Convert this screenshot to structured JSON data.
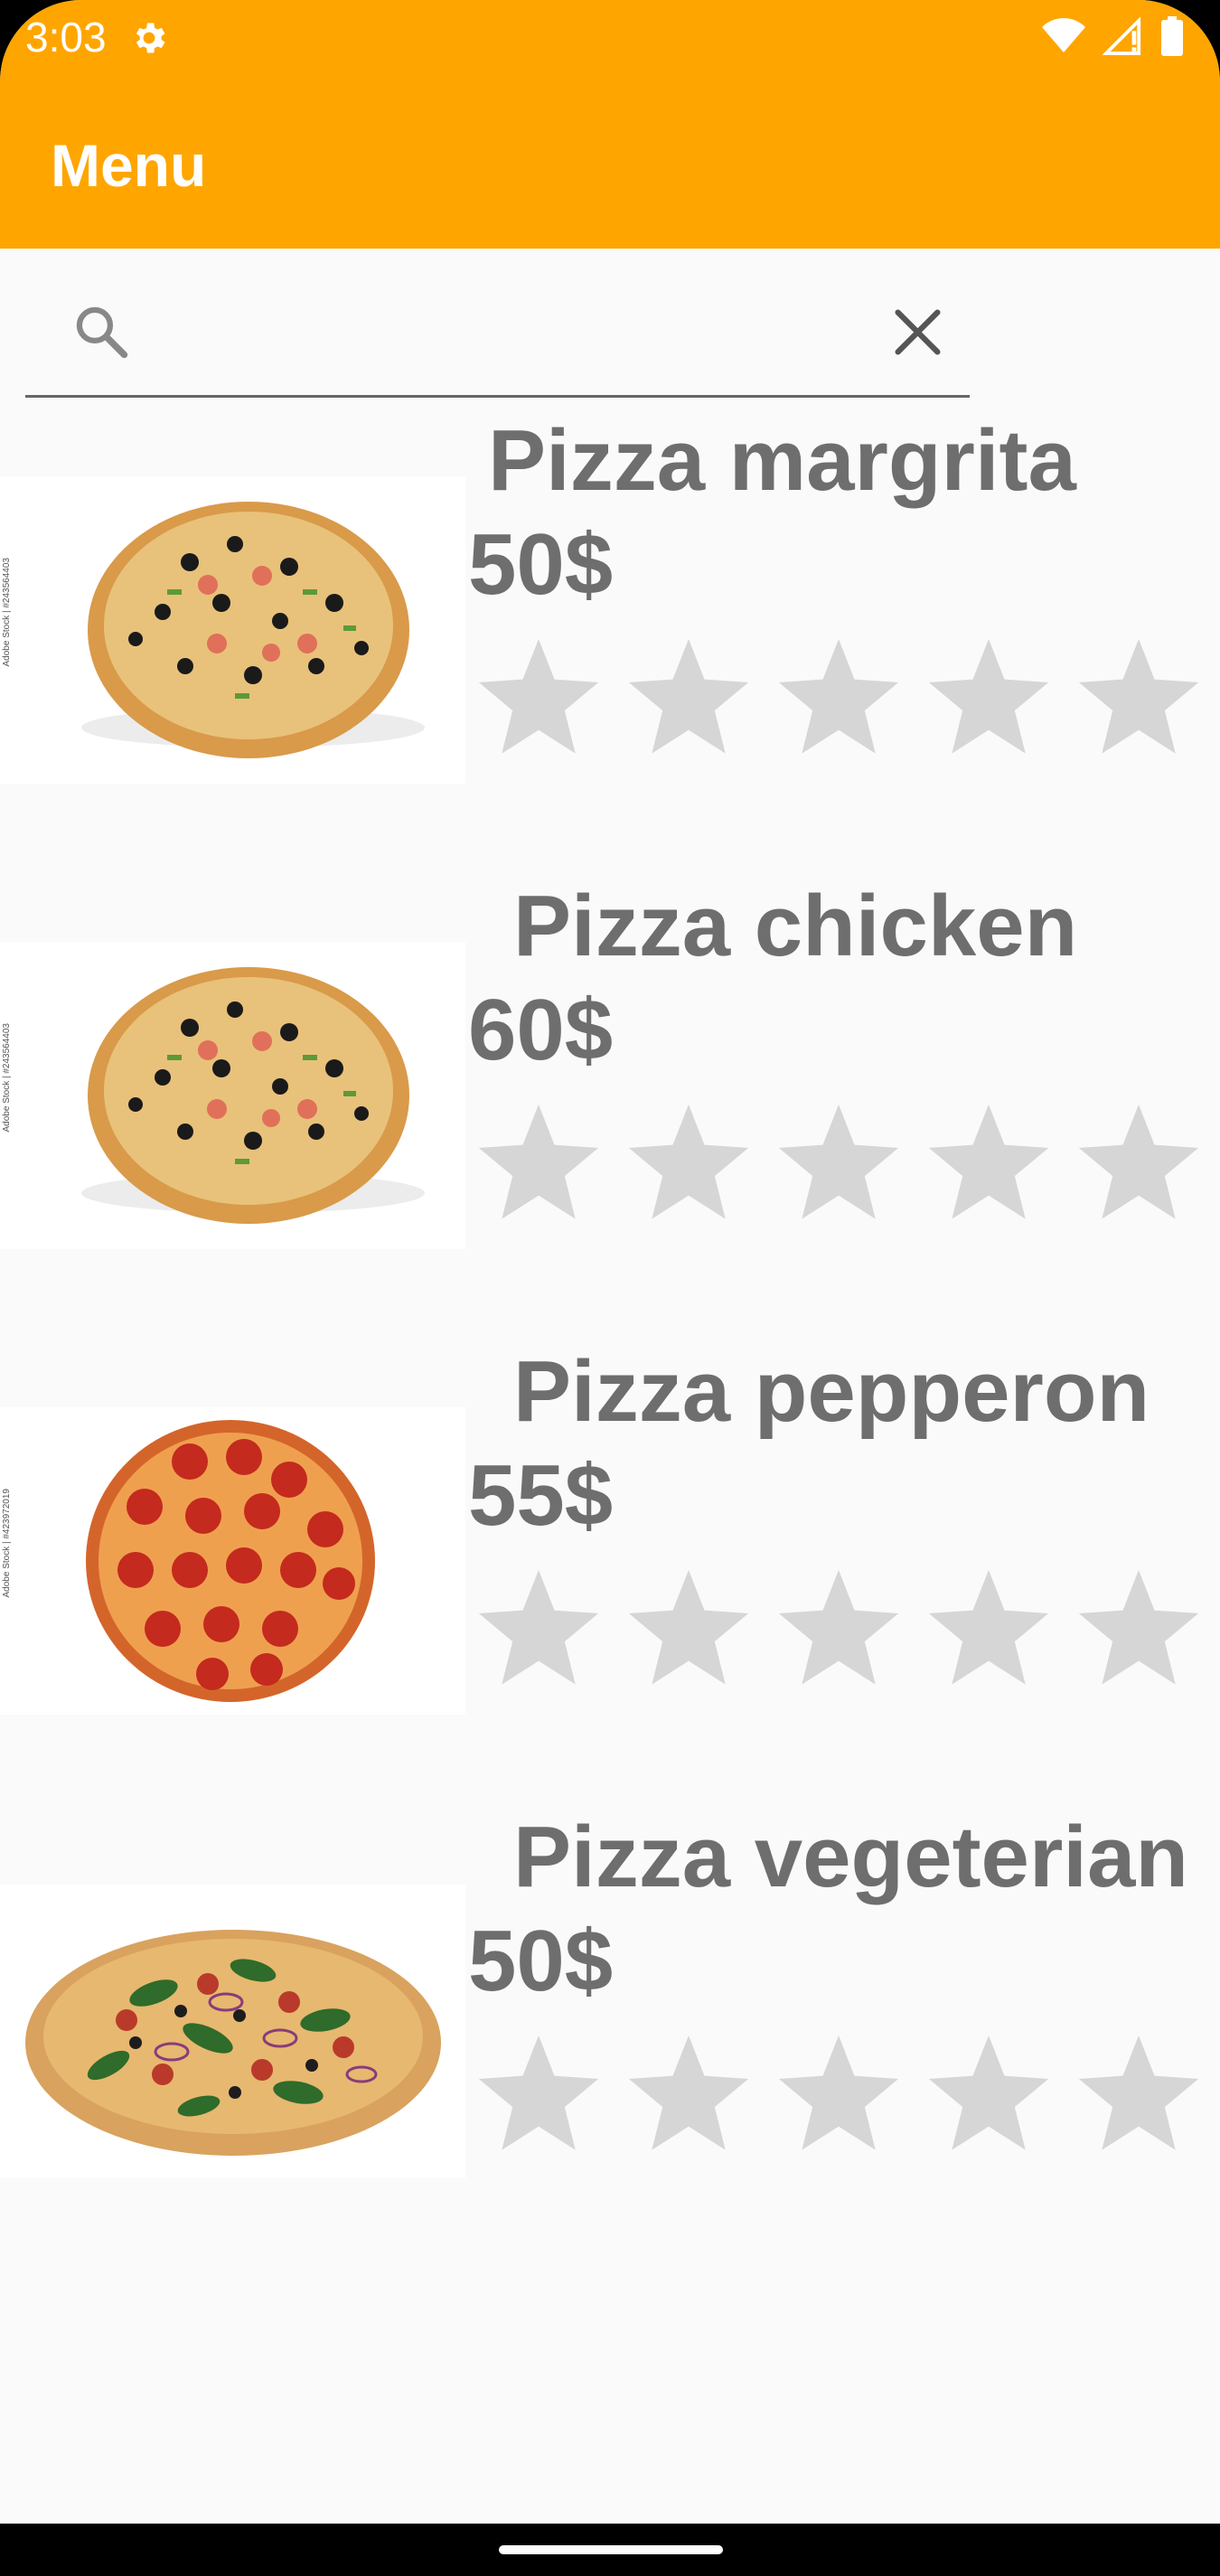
{
  "status_bar": {
    "time": "3:03"
  },
  "app_bar": {
    "title": "Menu"
  },
  "search": {
    "value": "",
    "placeholder": ""
  },
  "menu_items": [
    {
      "name": "Pizza margrita",
      "price": "50$",
      "rating": 0,
      "max_rating": 5,
      "image": "pizza-margrita-image",
      "watermark": "Adobe Stock | #243564403"
    },
    {
      "name": "Pizza chicken",
      "price": "60$",
      "rating": 0,
      "max_rating": 5,
      "image": "pizza-chicken-image",
      "watermark": "Adobe Stock | #243564403"
    },
    {
      "name": "Pizza pepperon",
      "price": "55$",
      "rating": 0,
      "max_rating": 5,
      "image": "pizza-pepperoni-image",
      "watermark": "Adobe Stock | #423972019"
    },
    {
      "name": "Pizza vegeterian",
      "price": "50$",
      "rating": 0,
      "max_rating": 5,
      "image": "pizza-vegetarian-image",
      "watermark": ""
    }
  ],
  "colors": {
    "accent": "#ffa500",
    "text": "#6e6e6e",
    "star_empty": "#d6d6d6"
  }
}
